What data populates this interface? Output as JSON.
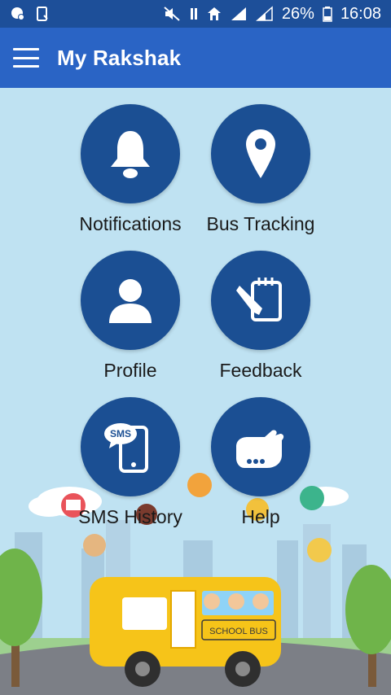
{
  "status_bar": {
    "battery": "26%",
    "time": "16:08"
  },
  "app_bar": {
    "title": "My Rakshak",
    "menu_icon": "hamburger-menu-icon"
  },
  "menu_tiles": [
    {
      "label": "Notifications",
      "icon": "bell-icon"
    },
    {
      "label": "Bus Tracking",
      "icon": "location-pin-icon"
    },
    {
      "label": "Profile",
      "icon": "person-icon"
    },
    {
      "label": "Feedback",
      "icon": "pen-notepad-icon"
    },
    {
      "label": "SMS History",
      "icon": "sms-phone-icon"
    },
    {
      "label": "Help",
      "icon": "helping-hand-icon"
    }
  ],
  "illustration": {
    "bus_sign": "SCHOOL BUS"
  },
  "colors": {
    "status_bar": "#1d4f99",
    "app_bar": "#2a64c5",
    "tile_circle": "#1b4f93",
    "background": "#bfe2f2"
  }
}
